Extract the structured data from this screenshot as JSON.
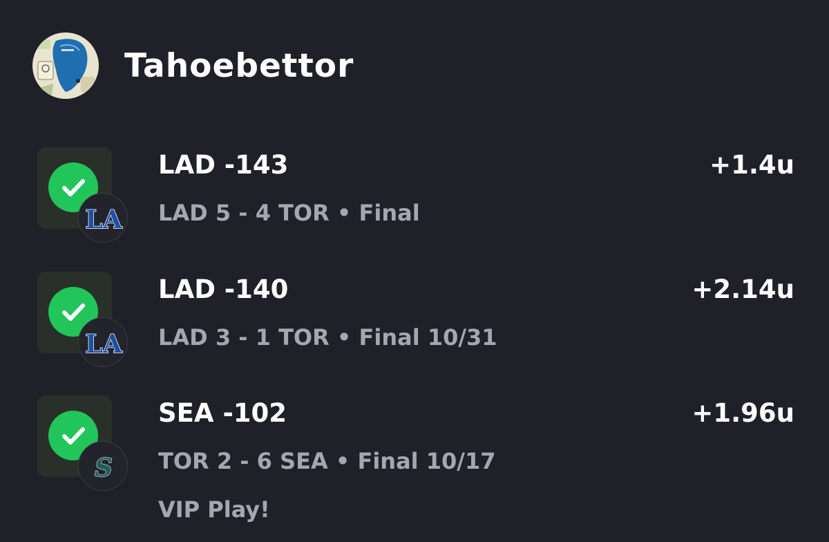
{
  "profile": {
    "username": "Tahoebettor"
  },
  "picks": [
    {
      "title": "LAD -143",
      "result": "+1.4u",
      "score": "LAD 5 - 4 TOR • Final",
      "team_logo_icon": "dodgers-la-logo-icon",
      "status_icon": "green-check-icon"
    },
    {
      "title": "LAD -140",
      "result": "+2.14u",
      "score": "LAD 3 - 1 TOR • Final 10/31",
      "team_logo_icon": "dodgers-la-logo-icon",
      "status_icon": "green-check-icon"
    },
    {
      "title": "SEA -102",
      "result": "+1.96u",
      "score": "TOR 2 - 6 SEA • Final 10/17",
      "note": "VIP Play!",
      "team_logo_icon": "mariners-s-logo-icon",
      "status_icon": "green-check-icon"
    }
  ],
  "colors": {
    "background": "#202029",
    "win_green": "#22c55a",
    "primary_text": "#ffffff",
    "secondary_text": "#a6a6b0"
  }
}
